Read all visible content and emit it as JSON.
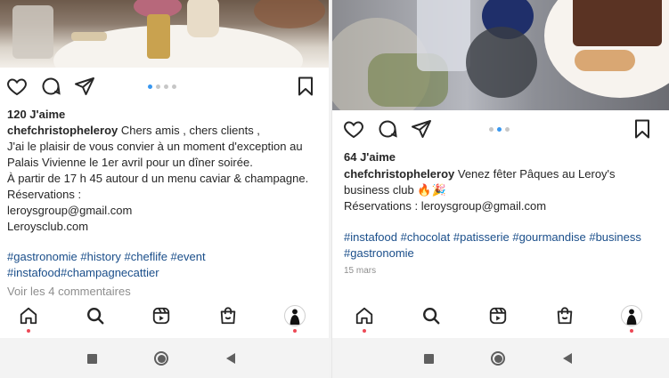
{
  "colors": {
    "link": "#1a4e8a",
    "accent": "#3897f0",
    "notification": "#ed4956",
    "muted": "#8e8e8e"
  },
  "left_post": {
    "likes": "120 J'aime",
    "username": "chefchristopheleroy",
    "caption_first": " Chers amis , chers clients ,",
    "caption_lines": [
      "J'ai le plaisir de vous convier à un moment d'exception au",
      "Palais Vivienne le 1er avril pour un dîner soirée.",
      "À partir de 17 h 45 autour d un menu caviar & champagne.",
      "Réservations :",
      "leroysgroup@gmail.com",
      "Leroysclub.com"
    ],
    "hashtags_line1": "#gastronomie #history #cheflife #event",
    "hashtags_line2": "#instafood#champagnecattier",
    "view_comments": "Voir les 4 commentaires",
    "icons": [
      "heart-icon",
      "comment-icon",
      "share-icon",
      "bookmark-icon"
    ]
  },
  "right_post": {
    "likes": "64 J'aime",
    "username": "chefchristopheleroy",
    "caption_first": " Venez fêter Pâques au Leroy's",
    "caption_lines": [
      "business club 🔥🎉",
      "Réservations : leroysgroup@gmail.com"
    ],
    "hashtags_line1": "#instafood #chocolat #patisserie #gourmandise #business",
    "hashtags_line2": "#gastronomie",
    "date": "15 mars",
    "icons": [
      "heart-icon",
      "comment-icon",
      "share-icon",
      "bookmark-icon"
    ]
  },
  "bottom_nav": [
    "home-icon",
    "search-icon",
    "reels-icon",
    "shop-icon",
    "profile-avatar"
  ],
  "system_nav": [
    "recents-button",
    "home-button",
    "back-button"
  ]
}
